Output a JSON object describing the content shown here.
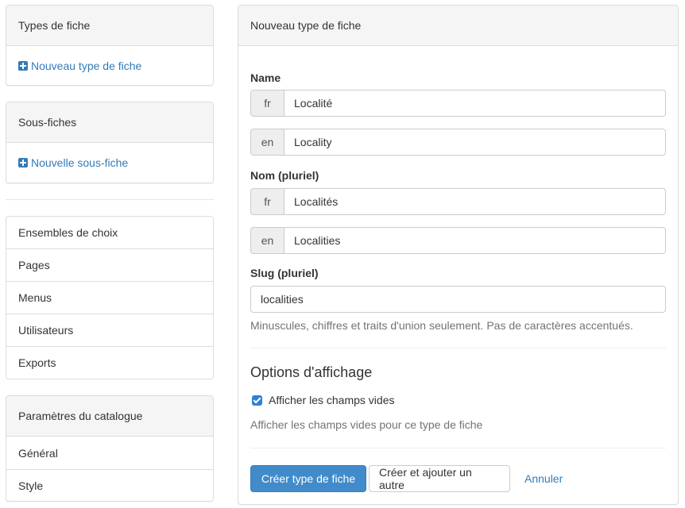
{
  "sidebar": {
    "types_panel": {
      "title": "Types de fiche",
      "add_link": "Nouveau type de fiche"
    },
    "subforms_panel": {
      "title": "Sous-fiches",
      "add_link": "Nouvelle sous-fiche"
    },
    "menu": [
      "Ensembles de choix",
      "Pages",
      "Menus",
      "Utilisateurs",
      "Exports"
    ],
    "catalog_params": {
      "title": "Paramètres du catalogue",
      "items": [
        "Général",
        "Style"
      ]
    }
  },
  "form": {
    "title": "Nouveau type de fiche",
    "name_label": "Name",
    "name_fr": {
      "lang": "fr",
      "value": "Localité"
    },
    "name_en": {
      "lang": "en",
      "value": "Locality"
    },
    "plural_label": "Nom (pluriel)",
    "plural_fr": {
      "lang": "fr",
      "value": "Localités"
    },
    "plural_en": {
      "lang": "en",
      "value": "Localities"
    },
    "slug_label": "Slug (pluriel)",
    "slug_value": "localities",
    "slug_help": "Minuscules, chiffres et traits d'union seulement. Pas de caractères accentués.",
    "options_title": "Options d'affichage",
    "show_empty_label": "Afficher les champs vides",
    "show_empty_checked": true,
    "show_empty_help": "Afficher les champs vides pour ce type de fiche",
    "buttons": {
      "create": "Créer type de fiche",
      "create_another": "Créer et ajouter un autre",
      "cancel": "Annuler"
    }
  },
  "colors": {
    "primary": "#428bca",
    "link": "#337ab7",
    "muted": "#737373"
  }
}
